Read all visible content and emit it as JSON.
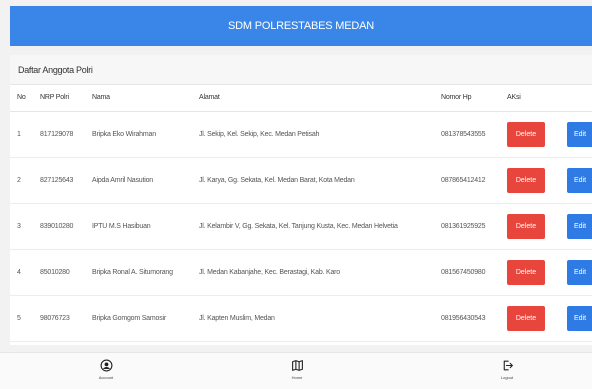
{
  "header": {
    "title": "SDM POLRESTABES MEDAN"
  },
  "card": {
    "title": "Daftar Anggota Polri"
  },
  "table": {
    "columns": [
      "No",
      "NRP Polri",
      "Nama",
      "Alamat",
      "Nomor Hp",
      "AKsi"
    ],
    "rows": [
      {
        "no": "1",
        "nrp": "817129078",
        "nama": "Bripka Eko Wirahman",
        "alamat": "Jl. Sekip, Kel. Sekip, Kec. Medan Petisah",
        "hp": "081378543555"
      },
      {
        "no": "2",
        "nrp": "827125643",
        "nama": "Aipda Amril Nasution",
        "alamat": "Jl. Karya, Gg. Sekata, Kel. Medan Barat, Kota Medan",
        "hp": "087865412412"
      },
      {
        "no": "3",
        "nrp": "839010280",
        "nama": "IPTU M.S Hasibuan",
        "alamat": "Jl. Kelambir V, Gg. Sekata, Kel. Tanjung Kusta, Kec. Medan Helvetia",
        "hp": "081361925925"
      },
      {
        "no": "4",
        "nrp": "85010280",
        "nama": "Bripka Ronal A. Situmorang",
        "alamat": "Jl. Medan Kabanjahe, Kec. Berastagi, Kab. Karo",
        "hp": "081567450980"
      },
      {
        "no": "5",
        "nrp": "98076723",
        "nama": "Bripka Gomgom Samosir",
        "alamat": "Jl. Kapten Muslim, Medan",
        "hp": "081956430543"
      }
    ],
    "delete_label": "Delete",
    "edit_label": "Edit"
  },
  "nav": {
    "account": "Account",
    "home": "Home",
    "logout": "Logout"
  },
  "colors": {
    "header": "#3a86e8",
    "delete": "#e8453c",
    "edit": "#2f7be6"
  },
  "icons": {
    "account": "user-circle-icon",
    "home": "map-icon",
    "logout": "logout-icon"
  }
}
